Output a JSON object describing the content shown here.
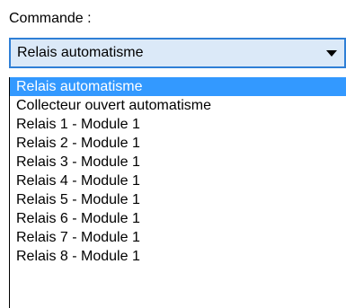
{
  "command": {
    "label": "Commande :",
    "selected_value": "Relais automatisme",
    "arrow_icon": "chevron-down-icon",
    "options": [
      "Relais automatisme",
      "Collecteur ouvert automatisme",
      "Relais 1 - Module 1",
      "Relais 2 - Module 1",
      "Relais 3 - Module 1",
      "Relais 4 - Module 1",
      "Relais 5 - Module 1",
      "Relais 6 - Module 1",
      "Relais 7 - Module 1",
      "Relais 8 - Module 1"
    ],
    "highlighted_index": 0
  },
  "colors": {
    "combo_border": "#2f7fd6",
    "combo_background": "#dbe9f8",
    "highlight": "#3399ff"
  }
}
